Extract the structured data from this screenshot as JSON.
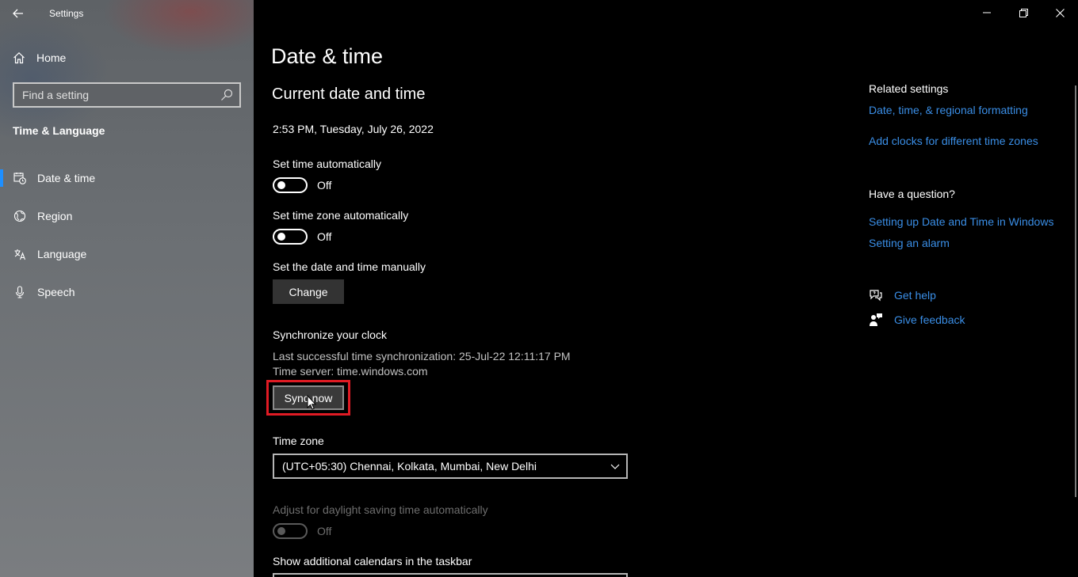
{
  "window": {
    "app_title": "Settings"
  },
  "sidebar": {
    "home_label": "Home",
    "search_placeholder": "Find a setting",
    "section_label": "Time & Language",
    "items": [
      {
        "label": "Date & time",
        "icon": "calendar-clock-icon",
        "active": true
      },
      {
        "label": "Region",
        "icon": "globe-icon",
        "active": false
      },
      {
        "label": "Language",
        "icon": "language-icon",
        "active": false
      },
      {
        "label": "Speech",
        "icon": "microphone-icon",
        "active": false
      }
    ]
  },
  "main": {
    "title": "Date & time",
    "subtitle": "Current date and time",
    "current_datetime": "2:53 PM, Tuesday, July 26, 2022",
    "set_time_auto": {
      "label": "Set time automatically",
      "state": "Off"
    },
    "set_timezone_auto": {
      "label": "Set time zone automatically",
      "state": "Off"
    },
    "manual": {
      "label": "Set the date and time manually",
      "button": "Change"
    },
    "sync": {
      "label": "Synchronize your clock",
      "last_sync": "Last successful time synchronization: 25-Jul-22 12:11:17 PM",
      "server": "Time server: time.windows.com",
      "button": "Sync now"
    },
    "timezone": {
      "label": "Time zone",
      "value": "(UTC+05:30) Chennai, Kolkata, Mumbai, New Delhi"
    },
    "daylight": {
      "label": "Adjust for daylight saving time automatically",
      "state": "Off"
    },
    "calendars_label": "Show additional calendars in the taskbar"
  },
  "related": {
    "heading": "Related settings",
    "links": [
      "Date, time, & regional formatting",
      "Add clocks for different time zones"
    ],
    "question_heading": "Have a question?",
    "question_links": [
      "Setting up Date and Time in Windows",
      "Setting an alarm"
    ],
    "get_help": "Get help",
    "give_feedback": "Give feedback"
  },
  "colors": {
    "accent": "#1e8fff",
    "link": "#3a8ee6",
    "highlight": "#e01b24"
  }
}
